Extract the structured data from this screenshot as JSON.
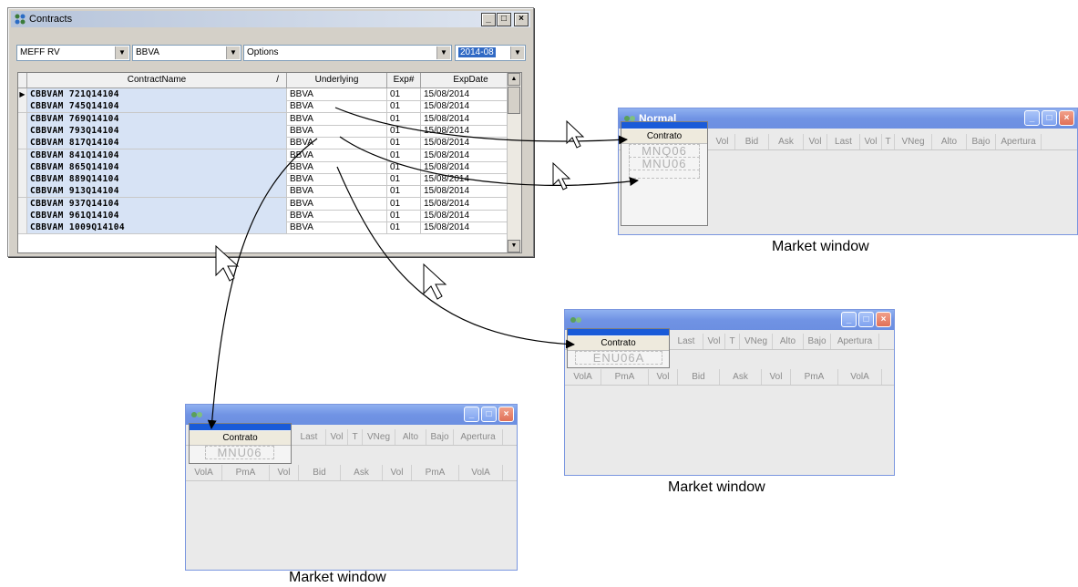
{
  "contracts_window": {
    "title": "Contracts",
    "buttons": {
      "minimize": "_",
      "maximize": "□",
      "close": "×"
    },
    "filters": {
      "market": "MEFF RV",
      "underlying": "BBVA",
      "type": "Options",
      "expiry": "2014-08"
    },
    "columns": [
      "ContractName",
      "/",
      "Underlying",
      "Exp#",
      "ExpDate"
    ],
    "current_row_marker": "▶",
    "rows": [
      {
        "name": "CBBVAM  721Q14104",
        "underlying": "BBVA",
        "exp": "01",
        "date": "15/08/2014"
      },
      {
        "name": "CBBVAM  745Q14104",
        "underlying": "BBVA",
        "exp": "01",
        "date": "15/08/2014"
      },
      {
        "name": "CBBVAM  769Q14104",
        "underlying": "BBVA",
        "exp": "01",
        "date": "15/08/2014"
      },
      {
        "name": "CBBVAM  793Q14104",
        "underlying": "BBVA",
        "exp": "01",
        "date": "15/08/2014"
      },
      {
        "name": "CBBVAM  817Q14104",
        "underlying": "BBVA",
        "exp": "01",
        "date": "15/08/2014"
      },
      {
        "name": "CBBVAM  841Q14104",
        "underlying": "BBVA",
        "exp": "01",
        "date": "15/08/2014"
      },
      {
        "name": "CBBVAM  865Q14104",
        "underlying": "BBVA",
        "exp": "01",
        "date": "15/08/2014"
      },
      {
        "name": "CBBVAM  889Q14104",
        "underlying": "BBVA",
        "exp": "01",
        "date": "15/08/2014"
      },
      {
        "name": "CBBVAM  913Q14104",
        "underlying": "BBVA",
        "exp": "01",
        "date": "15/08/2014"
      },
      {
        "name": "CBBVAM  937Q14104",
        "underlying": "BBVA",
        "exp": "01",
        "date": "15/08/2014"
      },
      {
        "name": "CBBVAM  961Q14104",
        "underlying": "BBVA",
        "exp": "01",
        "date": "15/08/2014"
      },
      {
        "name": "CBBVAM 1009Q14104",
        "underlying": "BBVA",
        "exp": "01",
        "date": "15/08/2014"
      }
    ]
  },
  "market_window_top": {
    "title": "Normal",
    "contract_header": "Contrato",
    "columns": [
      "Vol",
      "Bid",
      "Ask",
      "Vol",
      "Last",
      "Vol",
      "T",
      "VNeg",
      "Alto",
      "Bajo",
      "Apertura"
    ],
    "codes": [
      "MNQ06",
      "MNU06"
    ],
    "caption": "Market window"
  },
  "market_window_right": {
    "contract_header": "Contrato",
    "columns": [
      "Last",
      "Vol",
      "T",
      "VNeg",
      "Alto",
      "Bajo",
      "Apertura"
    ],
    "code": "ENU06A",
    "depth_columns": [
      "VolA",
      "PmA",
      "Vol",
      "Bid",
      "Ask",
      "Vol",
      "PmA",
      "VolA"
    ],
    "caption": "Market window"
  },
  "market_window_bottom": {
    "contract_header": "Contrato",
    "columns": [
      "Last",
      "Vol",
      "T",
      "VNeg",
      "Alto",
      "Bajo",
      "Apertura"
    ],
    "code": "MNU06",
    "depth_columns": [
      "VolA",
      "PmA",
      "Vol",
      "Bid",
      "Ask",
      "Vol",
      "PmA",
      "VolA"
    ],
    "caption": "Market window"
  },
  "colors": {
    "selection_blue": "#316ac5",
    "name_column_bg": "#d7e3f5",
    "xp_title": "#7093e4",
    "contract_bar": "#1a5bd8"
  },
  "icons": [
    "contracts-app-icon",
    "market-app-icon",
    "drag-cursor-icon"
  ]
}
